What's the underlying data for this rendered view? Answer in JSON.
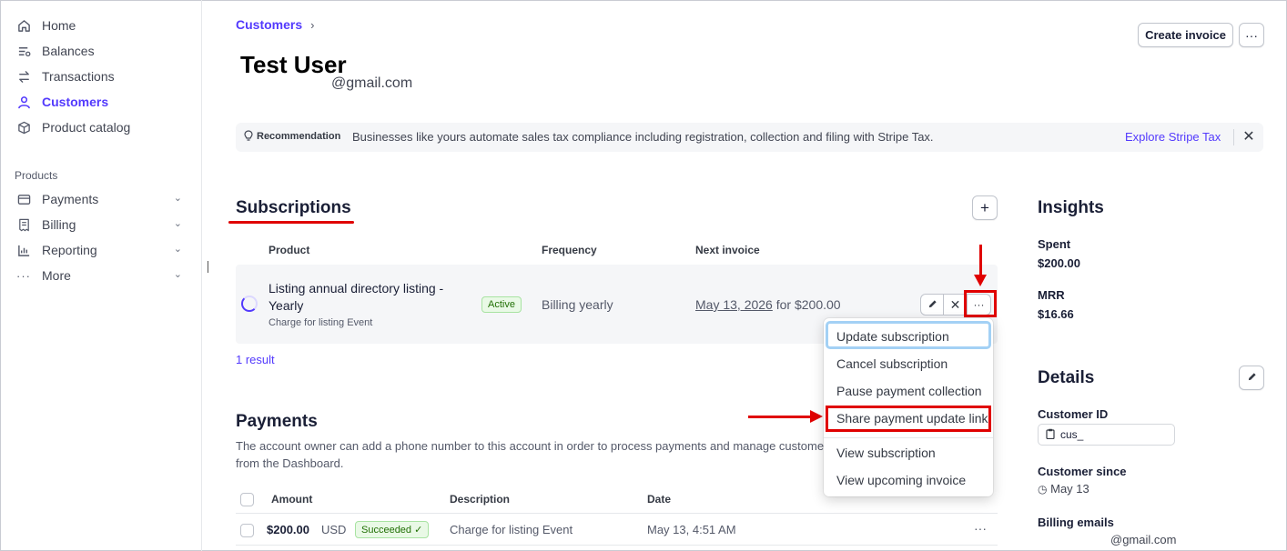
{
  "sidebar": {
    "items": [
      {
        "label": "Home",
        "icon": "home-icon"
      },
      {
        "label": "Balances",
        "icon": "balances-icon"
      },
      {
        "label": "Transactions",
        "icon": "transactions-icon"
      },
      {
        "label": "Customers",
        "icon": "user-icon"
      },
      {
        "label": "Product catalog",
        "icon": "box-icon"
      }
    ],
    "section_label": "Products",
    "product_items": [
      {
        "label": "Payments",
        "icon": "payments-icon"
      },
      {
        "label": "Billing",
        "icon": "billing-icon"
      },
      {
        "label": "Reporting",
        "icon": "reporting-icon"
      },
      {
        "label": "More",
        "icon": "more-dots-icon"
      }
    ]
  },
  "header": {
    "breadcrumb": "Customers",
    "title": "Test User",
    "email": "@gmail.com",
    "create_invoice_label": "Create invoice",
    "more_label": "···"
  },
  "recommendation": {
    "label": "Recommendation",
    "message": "Businesses like yours automate sales tax compliance including registration, collection and filing with Stripe Tax.",
    "link": "Explore Stripe Tax",
    "close": "✕"
  },
  "subscriptions": {
    "title": "Subscriptions",
    "add_label": "+",
    "columns": [
      "Product",
      "Frequency",
      "Next invoice"
    ],
    "rows": [
      {
        "product": "Listing annual directory listing - Yearly",
        "description": "Charge for listing Event",
        "status": "Active",
        "frequency": "Billing yearly",
        "next_invoice_date": "May 13, 2026",
        "next_invoice_amount": " for $200.00"
      }
    ],
    "result_count": "1 result"
  },
  "row_menu": {
    "items": [
      "Update subscription",
      "Cancel subscription",
      "Pause payment collection",
      "Share payment update link",
      "View subscription",
      "View upcoming invoice"
    ]
  },
  "payments": {
    "title": "Payments",
    "description": "The account owner can add a phone number to this account in order to process payments and manage customers from the Dashboard.",
    "columns": [
      "Amount",
      "Description",
      "Date"
    ],
    "rows": [
      {
        "amount": "$200.00",
        "currency": "USD",
        "status": "Succeeded ✓",
        "description": "Charge for listing Event",
        "date": "May 13, 4:51 AM"
      }
    ]
  },
  "insights": {
    "title": "Insights",
    "spent_label": "Spent",
    "spent_value": "$200.00",
    "mrr_label": "MRR",
    "mrr_value": "$16.66"
  },
  "details": {
    "title": "Details",
    "customer_id_label": "Customer ID",
    "customer_id_value": "cus_",
    "customer_since_label": "Customer since",
    "customer_since_value": "May 13",
    "billing_emails_label": "Billing emails",
    "billing_email_value": "@gmail.com"
  },
  "colors": {
    "accent": "#533afd",
    "annotation_red": "#e00000",
    "success": "#217005"
  }
}
